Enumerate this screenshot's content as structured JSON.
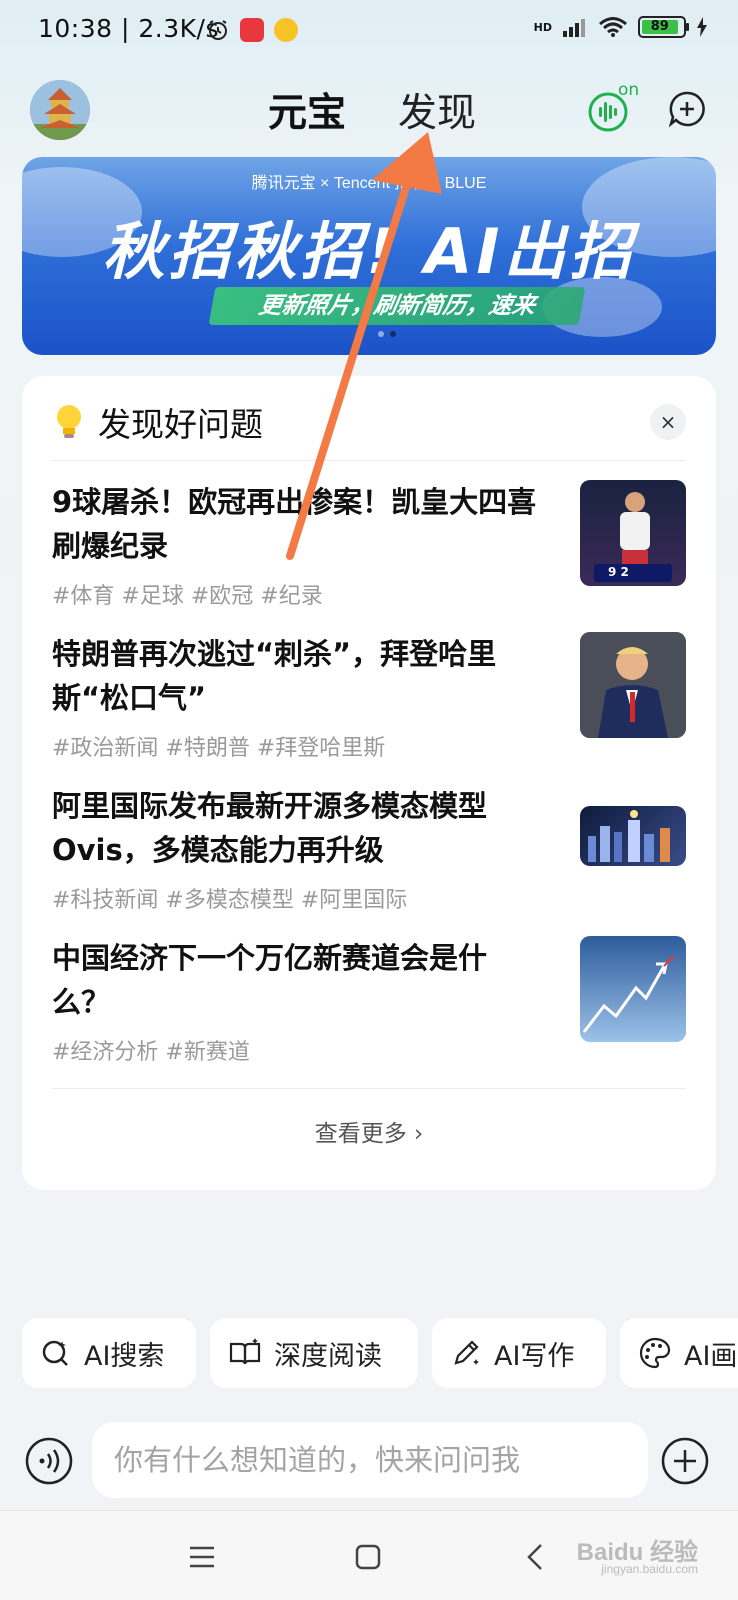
{
  "status_bar": {
    "time": "10:38 | 2.3K/s",
    "network_label": "HD",
    "battery_level": "89"
  },
  "header": {
    "tabs": [
      {
        "label": "元宝"
      },
      {
        "label": "发现"
      }
    ],
    "voice_badge": "on"
  },
  "banner": {
    "brand_line": "腾讯元宝 × Tencent   招聘 × BLUE",
    "title": "秋招秋招! AI出招",
    "subtitle": "更新照片，刷新简历，速来",
    "dots": 2,
    "active_dot": 1
  },
  "discover_card": {
    "title": "发现好问题",
    "close_label": "×",
    "items": [
      {
        "title": "9球屠杀！欧冠再出惨案！凯皇大四喜刷爆纪录",
        "tags": "#体育 #足球 #欧冠 #纪录",
        "thumb": "football-player-thumbnail",
        "score": "9 2"
      },
      {
        "title": "特朗普再次逃过“刺杀”，拜登哈里斯“松口气”",
        "tags": "#政治新闻 #特朗普 #拜登哈里斯",
        "thumb": "politician-thumbnail"
      },
      {
        "title": "阿里国际发布最新开源多模态模型Ovis，多模态能力再升级",
        "tags": "#科技新闻 #多模态模型 #阿里国际",
        "thumb": "tech-city-thumbnail"
      },
      {
        "title": "中国经济下一个万亿新赛道会是什么？",
        "tags": "#经济分析 #新赛道",
        "thumb": "growth-arrow-thumbnail"
      }
    ],
    "more_label": "查看更多 ›"
  },
  "quick_actions": [
    {
      "label": "AI搜索",
      "icon": "ai-search-icon"
    },
    {
      "label": "深度阅读",
      "icon": "book-icon"
    },
    {
      "label": "AI写作",
      "icon": "pen-icon"
    },
    {
      "label": "AI画",
      "icon": "palette-icon"
    }
  ],
  "input": {
    "placeholder": "你有什么想知道的，快来问问我"
  },
  "watermark": {
    "text": "Baidu 经验",
    "sub": "jingyan.baidu.com"
  },
  "colors": {
    "accent_green": "#20b24a",
    "banner_blue": "#2f6fd8",
    "arrow_orange": "#f47a45",
    "tag_gray": "#9a9a9a"
  }
}
